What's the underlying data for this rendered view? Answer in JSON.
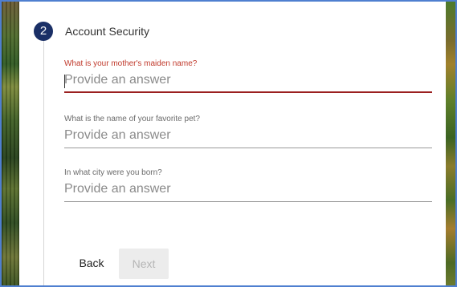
{
  "step": {
    "number": "2",
    "title": "Account Security"
  },
  "questions": [
    {
      "label": "What is your mother's maiden name?",
      "placeholder": "Provide an answer",
      "value": "",
      "state": "focused"
    },
    {
      "label": "What is the name of your favorite pet?",
      "placeholder": "Provide an answer",
      "value": ""
    },
    {
      "label": "In what city were you born?",
      "placeholder": "Provide an answer",
      "value": ""
    }
  ],
  "actions": {
    "back_label": "Back",
    "next_label": "Next",
    "next_disabled": true
  },
  "colors": {
    "step_badge": "#1a2f66",
    "focus_accent": "#9b2020",
    "focus_label": "#c0392b",
    "window_border": "#4f7fd0"
  }
}
